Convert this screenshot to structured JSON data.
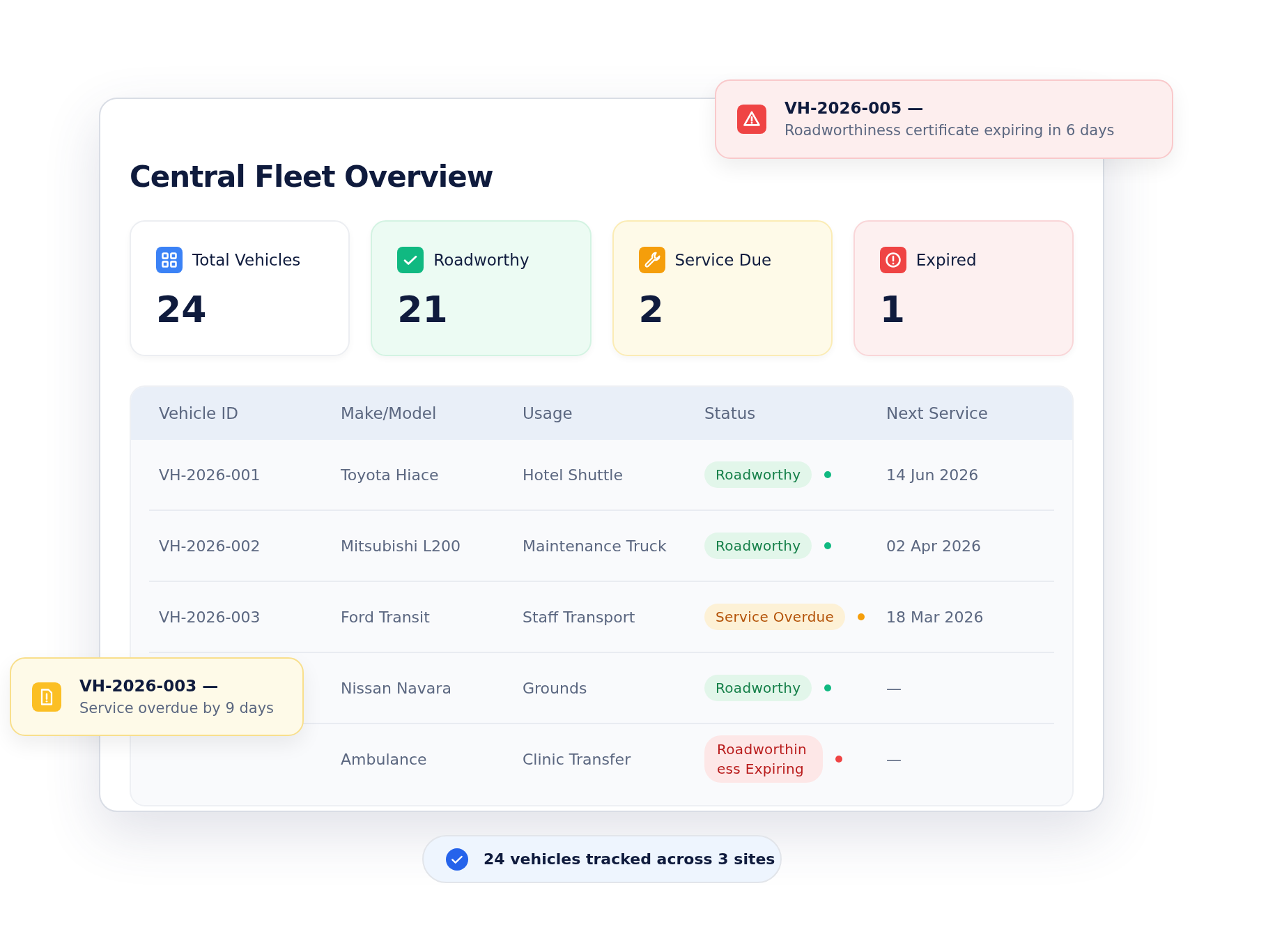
{
  "title": "Central Fleet Overview",
  "stats": [
    {
      "label": "Total Vehicles",
      "value": "24",
      "kind": "total"
    },
    {
      "label": "Roadworthy",
      "value": "21",
      "kind": "ok"
    },
    {
      "label": "Service Due",
      "value": "2",
      "kind": "due"
    },
    {
      "label": "Expired",
      "value": "1",
      "kind": "expired"
    }
  ],
  "table": {
    "columns": [
      "Vehicle ID",
      "Make/Model",
      "Usage",
      "Status",
      "Next Service"
    ],
    "rows": [
      {
        "vehicle_id": "VH-2026-001",
        "make_model": "Toyota Hiace",
        "usage": "Hotel Shuttle",
        "status": {
          "text": "Roadworthy",
          "kind": "ok"
        },
        "next_service": "14 Jun 2026"
      },
      {
        "vehicle_id": "VH-2026-002",
        "make_model": "Mitsubishi L200",
        "usage": "Maintenance Truck",
        "status": {
          "text": "Roadworthy",
          "kind": "ok"
        },
        "next_service": "02 Apr 2026"
      },
      {
        "vehicle_id": "VH-2026-003",
        "make_model": "Ford Transit",
        "usage": "Staff Transport",
        "status": {
          "text": "Service Overdue",
          "kind": "overdue"
        },
        "next_service": "18 Mar 2026"
      },
      {
        "make_model": "Nissan Navara",
        "usage": "Grounds",
        "status": {
          "text": "Roadworthy",
          "kind": "ok"
        },
        "next_service": "—"
      },
      {
        "make_model": "Ambulance",
        "usage": "Clinic Transfer",
        "status": {
          "text": "Roadworthiness Expiring",
          "kind": "expiring"
        },
        "next_service": "—"
      }
    ]
  },
  "alerts": [
    {
      "kind": "danger",
      "title": "VH-2026-005 —",
      "message": "Roadworthiness certificate expiring in 6 days"
    },
    {
      "kind": "warning",
      "title": "VH-2026-003 —",
      "message": "Service overdue by 9 days"
    }
  ],
  "footer": {
    "text": "24 vehicles tracked across 3 sites"
  }
}
